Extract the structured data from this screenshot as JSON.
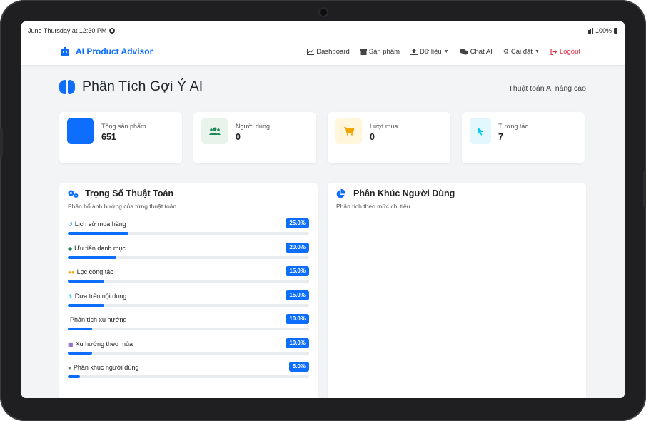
{
  "status": {
    "time": "June Thursday at 12:30 PM",
    "battery": "100%"
  },
  "brand": {
    "name": "AI Product Advisor"
  },
  "nav": {
    "dashboard": "Dashboard",
    "products": "Sản phẩm",
    "data": "Dữ liệu",
    "chat": "Chat AI",
    "settings": "Cài đặt",
    "logout": "Logout"
  },
  "header": {
    "title": "Phân Tích Gợi Ý AI",
    "right": "Thuật toán AI nâng cao"
  },
  "stats": [
    {
      "label": "Tổng sản phẩm",
      "value": "651",
      "icon": "box-icon",
      "color": "#0d6efd"
    },
    {
      "label": "Người dùng",
      "value": "0",
      "icon": "users-icon",
      "color": "#198754"
    },
    {
      "label": "Lượt mua",
      "value": "0",
      "icon": "cart-icon",
      "color": "#ffc107"
    },
    {
      "label": "Tương tác",
      "value": "7",
      "icon": "pointer-icon",
      "color": "#0dcaf0"
    }
  ],
  "weights_panel": {
    "title": "Trọng Số Thuật Toán",
    "subtitle": "Phân bổ ảnh hưởng của từng thuật toán",
    "rows": [
      {
        "label": "Lịch sử mua hàng",
        "badge": "25.0%",
        "value": 25.0,
        "icon": "history-icon"
      },
      {
        "label": "Ưu tiên danh mục",
        "badge": "20.0%",
        "value": 20.0,
        "icon": "tags-icon"
      },
      {
        "label": "Lọc cộng tác",
        "badge": "15.0%",
        "value": 15.0,
        "icon": "people-icon"
      },
      {
        "label": "Dựa trên nội dung",
        "badge": "15.0%",
        "value": 15.0,
        "icon": "sitemap-icon"
      },
      {
        "label": "Phân tích xu hướng",
        "badge": "10.0%",
        "value": 10.0,
        "icon": "trend-icon"
      },
      {
        "label": "Xu hướng theo mùa",
        "badge": "10.0%",
        "value": 10.0,
        "icon": "calendar-icon"
      },
      {
        "label": "Phân khúc người dùng",
        "badge": "5.0%",
        "value": 5.0,
        "icon": "user-group-icon"
      }
    ]
  },
  "segments_panel": {
    "title": "Phân Khúc Người Dùng",
    "subtitle": "Phân tích theo mức chi tiêu"
  }
}
